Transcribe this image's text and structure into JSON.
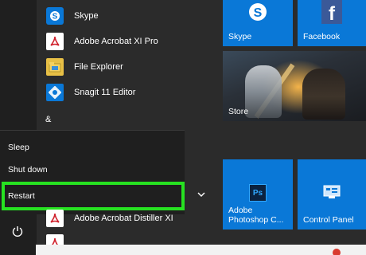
{
  "apps": [
    {
      "label": "Skype",
      "icon": "skype-icon"
    },
    {
      "label": "Adobe Acrobat XI Pro",
      "icon": "acrobat-icon"
    },
    {
      "label": "File Explorer",
      "icon": "folder-icon"
    },
    {
      "label": "Snagit 11 Editor",
      "icon": "snagit-icon"
    }
  ],
  "section_letter": "&",
  "power_menu": {
    "sleep": "Sleep",
    "shut_down": "Shut down",
    "restart": "Restart"
  },
  "apps_after": [
    {
      "label": "Adobe Acrobat Distiller XI",
      "icon": "acrobat-icon"
    }
  ],
  "tiles": {
    "skype": {
      "label": "Skype",
      "glyph": "S"
    },
    "facebook": {
      "label": "Facebook",
      "glyph": "f"
    },
    "store": {
      "label": "Store"
    },
    "photoshop": {
      "line1": "Adobe",
      "line2": "Photoshop C...",
      "glyph": "Ps"
    },
    "control_panel": {
      "label": "Control Panel"
    }
  },
  "colors": {
    "accent": "#0a78d7",
    "highlight": "#27e221",
    "menu_bg": "#1f1f1f",
    "start_bg": "#2b2b2b"
  }
}
